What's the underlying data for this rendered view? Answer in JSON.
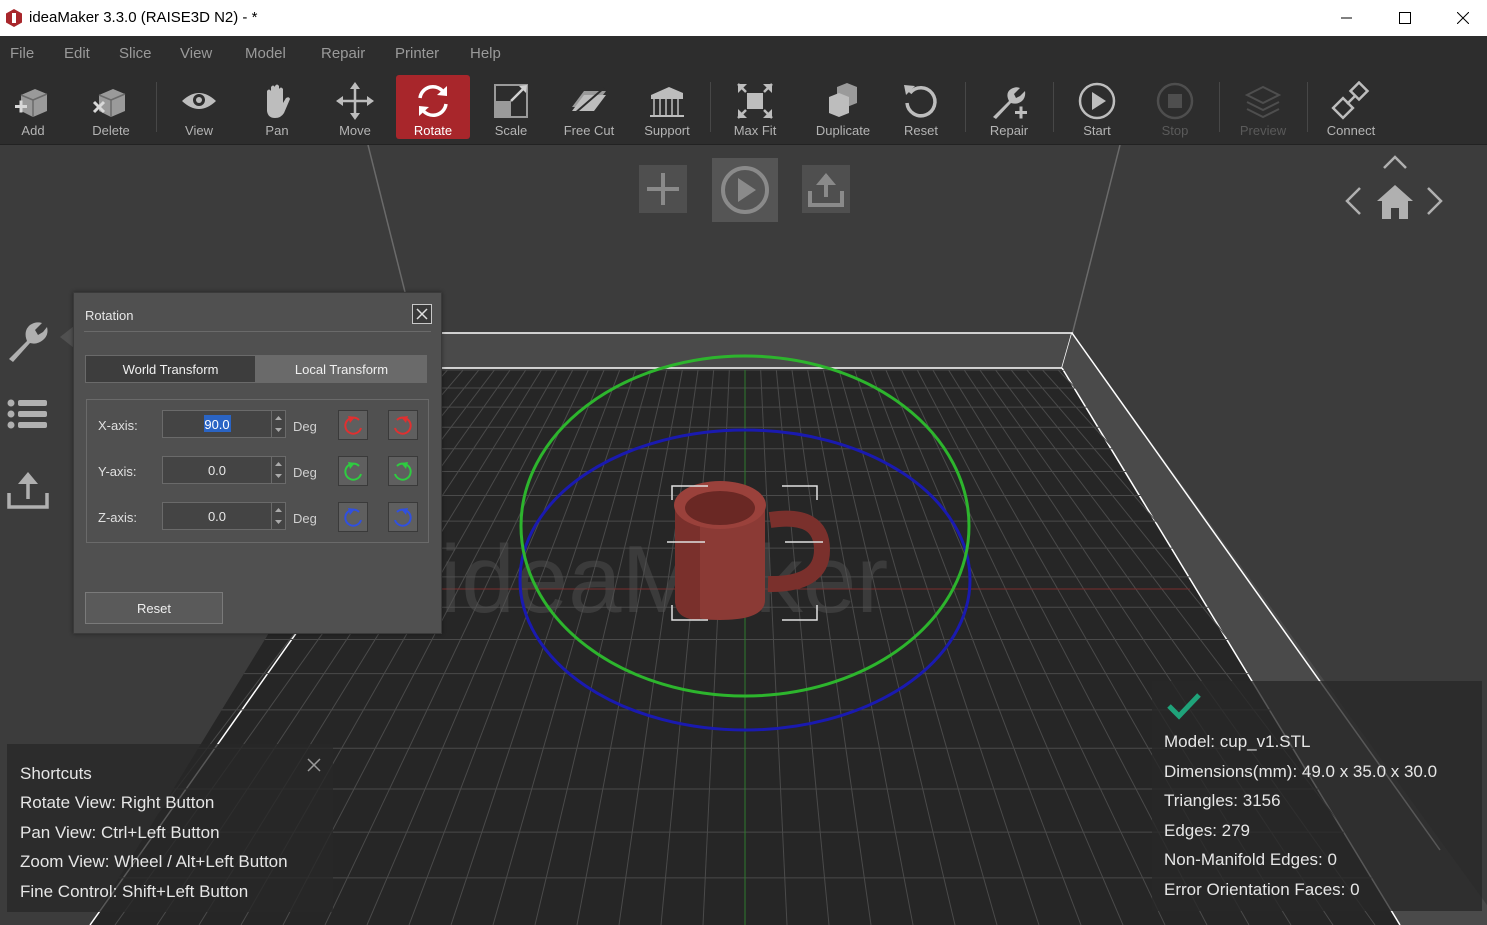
{
  "window": {
    "title": "ideaMaker 3.3.0 (RAISE3D N2) - *",
    "controls": {
      "minimize": "minimize-icon",
      "maximize": "maximize-icon",
      "close": "close-icon"
    }
  },
  "menu": {
    "items": [
      "File",
      "Edit",
      "Slice",
      "View",
      "Model",
      "Repair",
      "Printer",
      "Help"
    ]
  },
  "toolbar": {
    "active": "Rotate",
    "items": [
      {
        "label": "Add",
        "icon": "add-cube-icon"
      },
      {
        "label": "Delete",
        "icon": "delete-cube-icon"
      },
      {
        "label": "View",
        "icon": "eye-icon"
      },
      {
        "label": "Pan",
        "icon": "hand-icon"
      },
      {
        "label": "Move",
        "icon": "move-arrows-icon"
      },
      {
        "label": "Rotate",
        "icon": "rotate-icon"
      },
      {
        "label": "Scale",
        "icon": "scale-icon"
      },
      {
        "label": "Free Cut",
        "icon": "free-cut-icon"
      },
      {
        "label": "Support",
        "icon": "support-icon"
      },
      {
        "label": "Max Fit",
        "icon": "max-fit-icon"
      },
      {
        "label": "Duplicate",
        "icon": "duplicate-icon"
      },
      {
        "label": "Reset",
        "icon": "reset-icon"
      },
      {
        "label": "Repair",
        "icon": "wrench-plus-icon"
      },
      {
        "label": "Start",
        "icon": "play-icon"
      },
      {
        "label": "Stop",
        "icon": "stop-icon",
        "disabled": true
      },
      {
        "label": "Preview",
        "icon": "layers-icon",
        "disabled": true
      },
      {
        "label": "Connect",
        "icon": "connect-icon"
      }
    ]
  },
  "rotation_panel": {
    "title": "Rotation",
    "tabs": [
      "World Transform",
      "Local Transform"
    ],
    "active_tab": "World Transform",
    "axes": [
      {
        "label": "X-axis:",
        "value": "90.0",
        "unit": "Deg",
        "color": "#e03030"
      },
      {
        "label": "Y-axis:",
        "value": "0.0",
        "unit": "Deg",
        "color": "#2ecc40"
      },
      {
        "label": "Z-axis:",
        "value": "0.0",
        "unit": "Deg",
        "color": "#3050e0"
      }
    ],
    "reset_label": "Reset"
  },
  "shortcuts": {
    "title": "Shortcuts",
    "lines": [
      "Rotate View: Right Button",
      "Pan View: Ctrl+Left Button",
      "Zoom View: Wheel / Alt+Left Button",
      "Fine Control: Shift+Left Button"
    ]
  },
  "model_info": {
    "status_icon": "checkmark-icon",
    "lines": [
      "Model: cup_v1.STL",
      "Dimensions(mm): 49.0 x 35.0 x 30.0",
      "Triangles: 3156",
      "Edges: 279",
      "Non-Manifold Edges: 0",
      "Error Orientation Faces: 0"
    ]
  },
  "viewport": {
    "watermark": "ideaMaker",
    "quick_actions": [
      "add-icon",
      "play-icon",
      "export-icon"
    ],
    "side_icons": [
      "wrench-icon",
      "list-icon",
      "upload-icon"
    ],
    "nav_icons": [
      "chevron-up-icon",
      "chevron-left-icon",
      "home-icon",
      "chevron-right-icon"
    ]
  },
  "colors": {
    "accent": "#a8262b",
    "model": "#8b3a35",
    "ring_green": "#2db52d",
    "ring_blue": "#1a1ab0",
    "check": "#1fa37a"
  }
}
